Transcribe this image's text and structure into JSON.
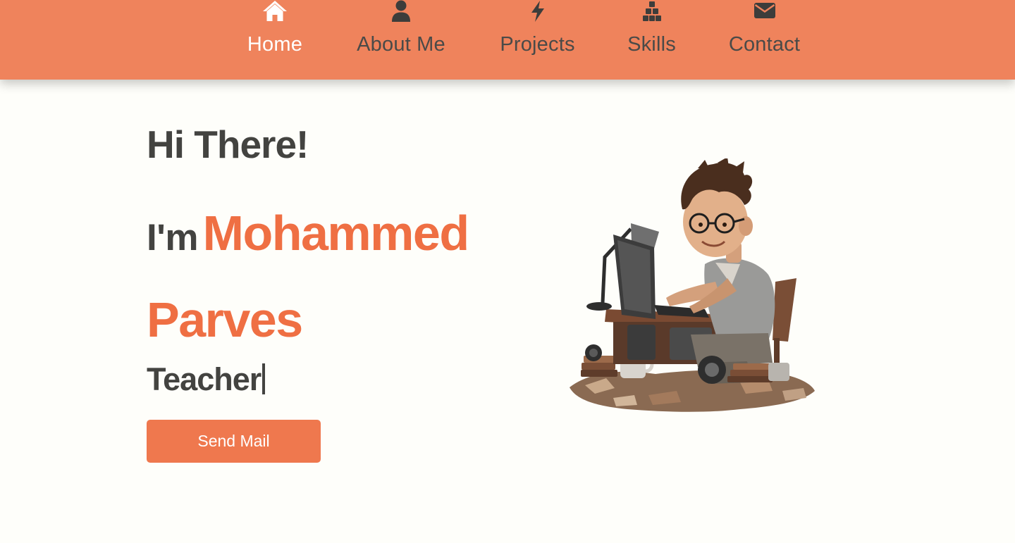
{
  "colors": {
    "navbar": "#ef835c",
    "accent": "#ef6f43",
    "button": "#ef784e",
    "text_dark": "#434340",
    "background": "#fefefa"
  },
  "nav": {
    "items": [
      {
        "label": "Home",
        "icon": "home-icon",
        "active": true
      },
      {
        "label": "About Me",
        "icon": "user-icon",
        "active": false
      },
      {
        "label": "Projects",
        "icon": "bolt-icon",
        "active": false
      },
      {
        "label": "Skills",
        "icon": "cubes-icon",
        "active": false
      },
      {
        "label": "Contact",
        "icon": "envelope-icon",
        "active": false
      }
    ]
  },
  "hero": {
    "greeting": "Hi There!",
    "name_prefix": "I'm",
    "name": "Mohammed Parves",
    "role": "Teacher",
    "button_label": "Send Mail",
    "illustration": "developer-at-computer-illustration"
  }
}
